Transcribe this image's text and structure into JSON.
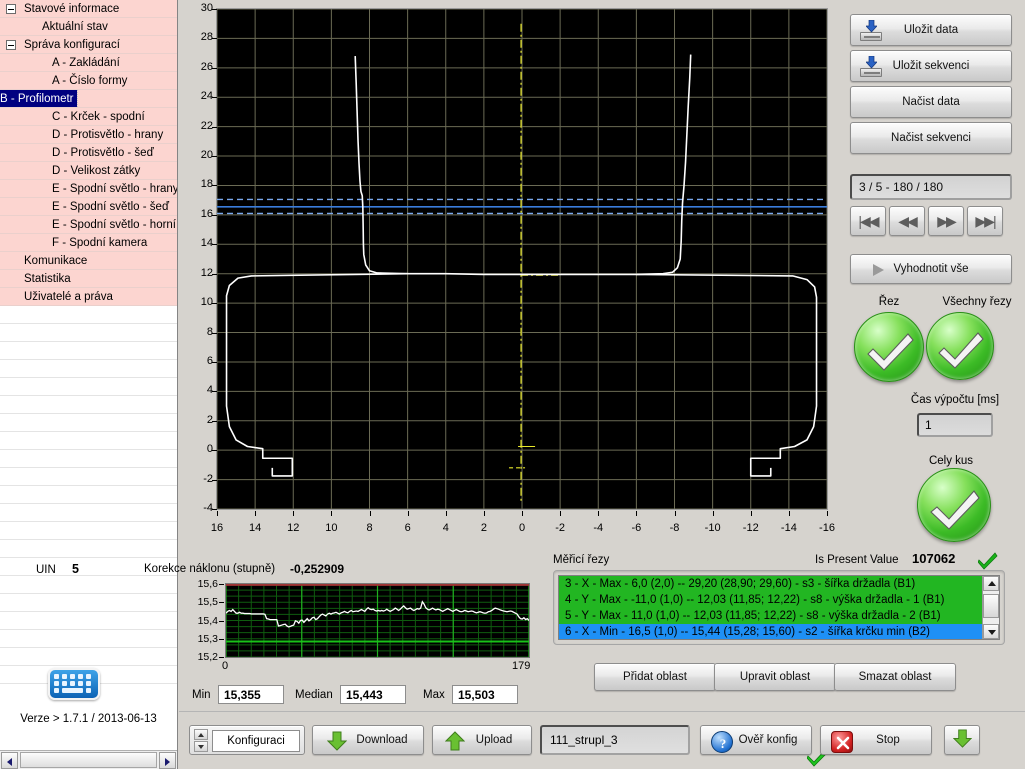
{
  "sidebar": {
    "items": [
      {
        "label": "Stavové informace",
        "level": 1,
        "expander": true,
        "selected": false
      },
      {
        "label": "Aktuální stav",
        "level": 2,
        "expander": false,
        "selected": false
      },
      {
        "label": "Správa konfigurací",
        "level": 1,
        "expander": true,
        "selected": false
      },
      {
        "label": "A - Zakládání",
        "level": 3,
        "expander": false,
        "selected": false
      },
      {
        "label": "A - Číslo formy",
        "level": 3,
        "expander": false,
        "selected": false
      },
      {
        "label": "B - Profilometr",
        "level": 3,
        "expander": false,
        "selected": true
      },
      {
        "label": "C - Krček - spodní",
        "level": 3,
        "expander": false,
        "selected": false
      },
      {
        "label": "D - Protisvětlo - hrany",
        "level": 3,
        "expander": false,
        "selected": false
      },
      {
        "label": "D - Protisvětlo - šeď",
        "level": 3,
        "expander": false,
        "selected": false
      },
      {
        "label": "D - Velikost zátky",
        "level": 3,
        "expander": false,
        "selected": false
      },
      {
        "label": "E - Spodní světlo - hrany",
        "level": 3,
        "expander": false,
        "selected": false
      },
      {
        "label": "E - Spodní světlo - šeď",
        "level": 3,
        "expander": false,
        "selected": false
      },
      {
        "label": "E - Spodní světlo - horní",
        "level": 3,
        "expander": false,
        "selected": false
      },
      {
        "label": "F - Spodní kamera",
        "level": 3,
        "expander": false,
        "selected": false
      },
      {
        "label": "Komunikace",
        "level": 1,
        "expander": false,
        "selected": false
      },
      {
        "label": "Statistika",
        "level": 1,
        "expander": false,
        "selected": false
      },
      {
        "label": "Uživatelé a práva",
        "level": 1,
        "expander": false,
        "selected": false
      }
    ],
    "version_text": "Verze > 1.7.1 / 2013-06-13",
    "keyboard_icon": "keyboard-icon"
  },
  "right_panel": {
    "save_data": "Uložit data",
    "save_sequence": "Uložit sekvenci",
    "load_data": "Načist data",
    "load_sequence": "Načist sekvenci",
    "sequence_display": "3 / 5 - 180 / 180",
    "nav": [
      {
        "name": "first",
        "glyph": "|◀◀"
      },
      {
        "name": "previous",
        "glyph": "◀◀"
      },
      {
        "name": "next",
        "glyph": "▶▶"
      },
      {
        "name": "last",
        "glyph": "▶▶|"
      }
    ],
    "evaluate_all": "Vyhodnotit vše",
    "cut_label": "Řez",
    "all_cuts_label": "Všechny řezy",
    "calc_time_label": "Čas výpočtu [ms]",
    "calc_time_value": "1",
    "whole_part_label": "Cely kus",
    "status_ok_color": "#3cbb26"
  },
  "chart_data": {
    "type": "line",
    "title": "",
    "xlabel": "",
    "ylabel": "",
    "xlim": [
      16,
      -16
    ],
    "ylim": [
      -4,
      30
    ],
    "xticks": [
      16,
      14,
      12,
      10,
      8,
      6,
      4,
      2,
      0,
      -2,
      -4,
      -6,
      -8,
      -10,
      -12,
      -14,
      -16
    ],
    "yticks": [
      30,
      28,
      26,
      24,
      22,
      20,
      18,
      16,
      14,
      12,
      10,
      8,
      6,
      4,
      2,
      0,
      -2,
      -4
    ],
    "grid": true,
    "background": "#000000",
    "series": [
      {
        "name": "profile",
        "color": "#ffffff",
        "points": [
          [
            8.75,
            26.8
          ],
          [
            8.7,
            25.0
          ],
          [
            8.65,
            23.0
          ],
          [
            8.6,
            21.0
          ],
          [
            8.55,
            19.5
          ],
          [
            8.5,
            18.3
          ],
          [
            8.45,
            17.6
          ],
          [
            8.38,
            17.3
          ],
          [
            8.35,
            16.5
          ],
          [
            8.33,
            15.0
          ],
          [
            8.32,
            14.0
          ],
          [
            8.3,
            13.3
          ],
          [
            8.2,
            12.6
          ],
          [
            8.0,
            12.2
          ],
          [
            7.6,
            12.05
          ],
          [
            6.0,
            12.0
          ],
          [
            4.0,
            12.0
          ],
          [
            2.0,
            11.95
          ],
          [
            0.0,
            11.95
          ],
          [
            -2.0,
            11.95
          ],
          [
            -4.0,
            11.95
          ],
          [
            -6.0,
            11.95
          ],
          [
            -7.4,
            12.0
          ],
          [
            -7.9,
            12.1
          ],
          [
            -8.15,
            12.4
          ],
          [
            -8.3,
            13.0
          ],
          [
            -8.35,
            14.2
          ],
          [
            -8.38,
            15.6
          ],
          [
            -8.42,
            16.8
          ],
          [
            -8.5,
            18.0
          ],
          [
            -8.58,
            19.6
          ],
          [
            -8.65,
            21.5
          ],
          [
            -8.72,
            23.4
          ],
          [
            -8.8,
            25.3
          ],
          [
            -8.85,
            26.9
          ]
        ]
      },
      {
        "name": "profile-left-body",
        "color": "#ffffff",
        "points": [
          [
            6.0,
            12.0
          ],
          [
            14.2,
            11.85
          ],
          [
            14.9,
            11.7
          ],
          [
            15.35,
            11.2
          ],
          [
            15.5,
            10.5
          ],
          [
            15.5,
            3.0
          ],
          [
            15.35,
            1.6
          ],
          [
            15.0,
            0.7
          ],
          [
            14.4,
            0.25
          ],
          [
            13.6,
            0.1
          ],
          [
            13.6,
            -0.55
          ],
          [
            12.05,
            -0.55
          ],
          [
            12.05,
            -1.75
          ],
          [
            13.1,
            -1.75
          ],
          [
            13.1,
            -1.2
          ]
        ]
      },
      {
        "name": "profile-right-body",
        "color": "#ffffff",
        "points": [
          [
            -6.0,
            11.95
          ],
          [
            -14.2,
            11.85
          ],
          [
            -14.95,
            11.6
          ],
          [
            -15.35,
            11.1
          ],
          [
            -15.45,
            10.4
          ],
          [
            -15.45,
            3.0
          ],
          [
            -15.3,
            1.6
          ],
          [
            -14.95,
            0.7
          ],
          [
            -14.3,
            0.25
          ],
          [
            -13.55,
            0.1
          ],
          [
            -13.55,
            -0.55
          ],
          [
            -12.0,
            -0.55
          ],
          [
            -12.0,
            -1.75
          ],
          [
            -13.05,
            -1.75
          ],
          [
            -13.05,
            -1.2
          ]
        ]
      }
    ],
    "markers": {
      "blue_solid_y": 16.55,
      "blue_dashed_upper_y": 17.05,
      "blue_dashed_lower_y": 16.1,
      "blue_color": "#3a7ddc",
      "yellow_vertical_x": 0.05,
      "yellow_color": "#e8e82a",
      "yellow_tick_y": 11.9
    }
  },
  "mini_chart": {
    "uin_label": "UIN",
    "uin_value": "5",
    "correction_label": "Korekce náklonu (stupně)",
    "correction_value": "-0,252909",
    "type": "line",
    "yticks": [
      "15,6",
      "15,5",
      "15,4",
      "15,3",
      "15,2"
    ],
    "ylim": [
      15.2,
      15.6
    ],
    "xlim": [
      0,
      179
    ],
    "xticks": [
      "0",
      "179"
    ],
    "upper_limit_line": 15.595,
    "upper_limit_color": "#a03535",
    "lower_limit_line": 15.285,
    "lower_limit_color": "#19c219",
    "grid_color": "#0f5c0f",
    "trace_color": "#ffffff",
    "values": [
      15.44,
      15.45,
      15.455,
      15.45,
      15.46,
      15.45,
      15.44,
      15.44,
      15.445,
      15.44,
      15.44,
      15.438,
      15.438,
      15.438,
      15.438,
      15.436,
      15.436,
      15.436,
      15.436,
      15.436,
      15.436,
      15.436,
      15.436,
      15.434,
      15.41,
      15.408,
      15.405,
      15.405,
      15.405,
      15.405,
      15.405,
      15.37,
      15.372,
      15.375,
      15.378,
      15.38,
      15.37,
      15.365,
      15.368,
      15.372,
      15.375,
      15.398,
      15.395,
      15.385,
      15.4,
      15.402,
      15.39,
      15.4,
      15.41,
      15.398,
      15.405,
      15.415,
      15.418,
      15.405,
      15.41,
      15.42,
      15.43,
      15.435,
      15.43,
      15.425,
      15.435,
      15.44,
      15.435,
      15.44,
      15.442,
      15.445,
      15.44,
      15.435,
      15.442,
      15.445,
      15.45,
      15.445,
      15.442,
      15.45,
      15.455,
      15.448,
      15.45,
      15.452,
      15.45,
      15.455,
      15.46,
      15.455,
      15.45,
      15.462,
      15.47,
      15.462,
      15.46,
      15.462,
      15.455,
      15.452,
      15.455,
      15.452,
      15.455,
      15.452,
      15.455,
      15.462,
      15.455,
      15.45,
      15.455,
      15.46,
      15.468,
      15.462,
      15.455,
      15.462,
      15.472,
      15.48,
      15.47,
      15.462,
      15.465,
      15.468,
      15.46,
      15.455,
      15.46,
      15.465,
      15.462,
      15.468,
      15.503,
      15.49,
      15.47,
      15.462,
      15.458,
      15.462,
      15.468,
      15.462,
      15.458,
      15.462,
      15.46,
      15.455,
      15.45,
      15.455,
      15.46,
      15.465,
      15.46,
      15.455,
      15.45,
      15.455,
      15.46,
      15.455,
      15.45,
      15.448,
      15.45,
      15.455,
      15.452,
      15.448,
      15.45,
      15.452,
      15.45,
      15.445,
      15.442,
      15.445,
      15.448,
      15.445,
      15.442,
      15.44,
      15.442,
      15.448,
      15.45,
      15.455,
      15.462,
      15.468,
      15.465,
      15.462,
      15.458,
      15.455,
      15.452,
      15.45,
      15.448,
      15.45,
      15.452,
      15.45,
      15.445,
      15.44,
      15.435,
      15.42,
      15.41,
      15.408,
      15.415,
      15.405,
      15.41,
      15.4
    ],
    "min_label": "Min",
    "min_value": "15,355",
    "median_label": "Median",
    "median_value": "15,443",
    "max_label": "Max",
    "max_value": "15,503"
  },
  "measuring_cuts": {
    "title": "Měřicí řezy",
    "present_value_label": "Is Present Value",
    "present_value": "107062",
    "rows": [
      {
        "text": "3 - X - Max - 6,0 (2,0) -- 29,20 (28,90; 29,60) - s3 - šířka držadla (B1)",
        "state": "green"
      },
      {
        "text": "4 - Y - Max - -11,0 (1,0) -- 12,03 (11,85; 12,22) - s8 - výška držadla - 1 (B1)",
        "state": "green"
      },
      {
        "text": "5 - Y - Max - 11,0 (1,0) -- 12,03 (11,85; 12,22) - s8 - výška držadla - 2 (B1)",
        "state": "green"
      },
      {
        "text": "6 - X - Min - 16,5 (1,0) -- 15,44 (15,28; 15,60) - s2 - šířka krčku min (B2)",
        "state": "blue"
      }
    ],
    "add_area": "Přidat oblast",
    "edit_area": "Upravit oblast",
    "delete_area": "Smazat oblast"
  },
  "toolbar": {
    "konfiguraci": "Konfiguraci",
    "download": "Download",
    "upload": "Upload",
    "filename": "111_strupl_3",
    "verify_config": "Ověř konfig",
    "stop": "Stop"
  }
}
